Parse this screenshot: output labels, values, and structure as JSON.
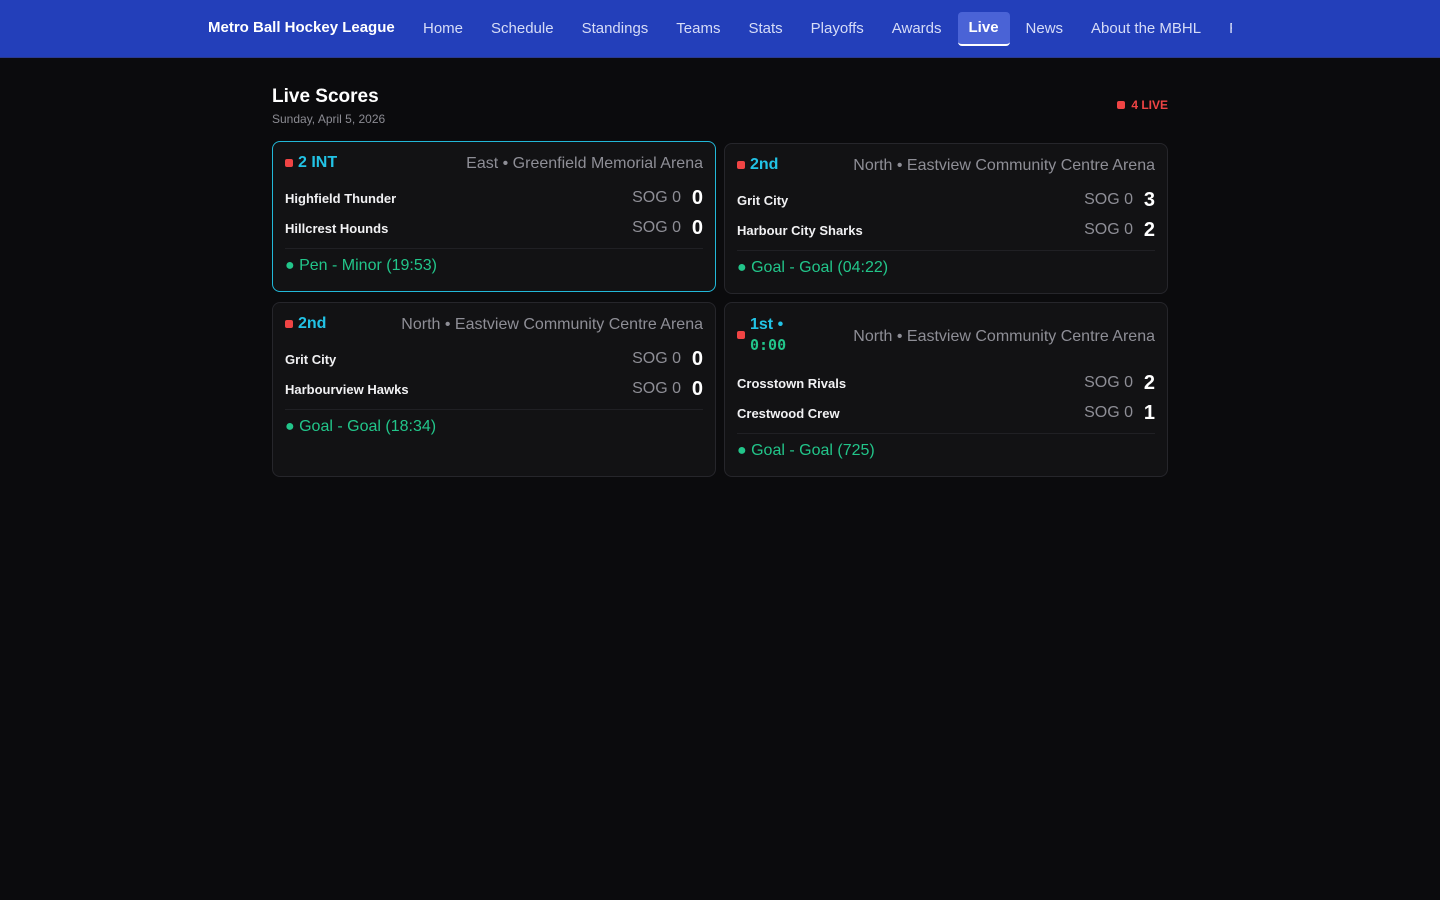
{
  "header": {
    "brand": "Metro Ball Hockey League",
    "nav": [
      "Home",
      "Schedule",
      "Standings",
      "Teams",
      "Stats",
      "Playoffs",
      "Awards",
      "Live",
      "News",
      "About the MBHL",
      "Ru"
    ],
    "active_nav": "Live"
  },
  "main": {
    "title": "Live Scores",
    "date": "Sunday, April 5, 2026",
    "live_count": "4 LIVE"
  },
  "games": [
    {
      "period": "2 INT",
      "venue": "East • Greenfield Memorial Arena",
      "home": {
        "name": "Highfield Thunder",
        "sog": "SOG 0",
        "score": "0"
      },
      "away": {
        "name": "Hillcrest Hounds",
        "sog": "SOG 0",
        "score": "0"
      },
      "event": "● Pen - Minor (19:53)"
    },
    {
      "period": "2nd",
      "venue": "North • Eastview Community Centre Arena",
      "home": {
        "name": "Grit City",
        "sog": "SOG 0",
        "score": "3"
      },
      "away": {
        "name": "Harbour City Sharks",
        "sog": "SOG 0",
        "score": "2"
      },
      "event": "● Goal - Goal (04:22)"
    },
    {
      "period": "2nd",
      "venue": "North • Eastview Community Centre Arena",
      "home": {
        "name": "Grit City",
        "sog": "SOG 0",
        "score": "0"
      },
      "away": {
        "name": "Harbourview Hawks",
        "sog": "SOG 0",
        "score": "0"
      },
      "event": "● Goal - Goal (18:34)"
    },
    {
      "period": "1st •",
      "clock": "0:00",
      "venue": "North • Eastview Community Centre Arena",
      "home": {
        "name": "Crosstown Rivals",
        "sog": "SOG 0",
        "score": "2"
      },
      "away": {
        "name": "Crestwood Crew",
        "sog": "SOG 0",
        "score": "1"
      },
      "event": "● Goal - Goal (725)"
    }
  ],
  "colors": {
    "accent_nav": "#233fba",
    "live_red": "#ef4444",
    "period_cyan": "#22c3e6",
    "event_green": "#22c58a"
  }
}
